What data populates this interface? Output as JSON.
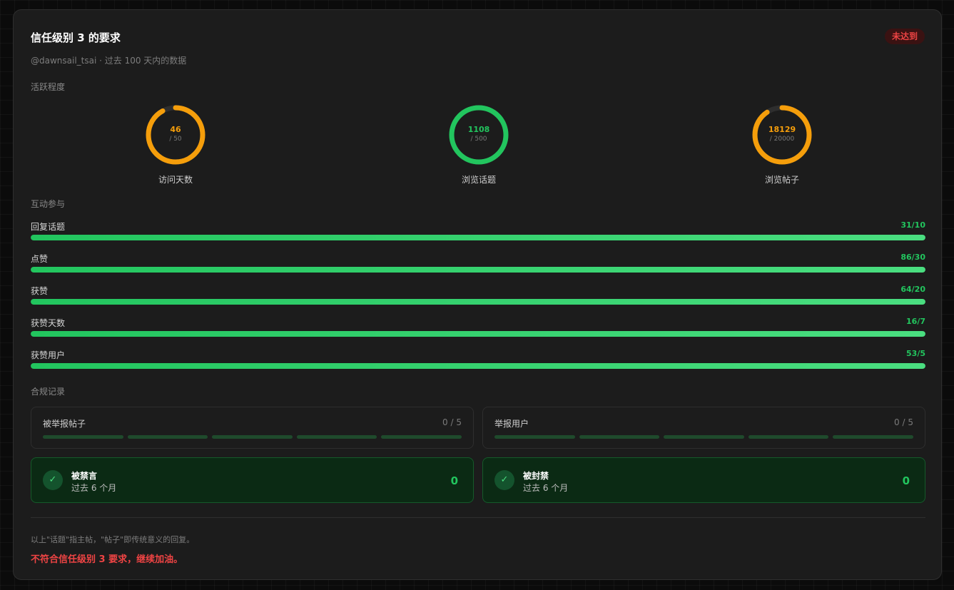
{
  "header": {
    "title": "信任级别 3 的要求",
    "badge": "未达到",
    "subtitle": "@dawnsail_tsai · 过去 100 天内的数据"
  },
  "sections": {
    "activity": "活跃程度",
    "engagement": "互动参与",
    "compliance": "合规记录"
  },
  "rings": [
    {
      "value": "46",
      "max": "/ 50",
      "label": "访问天数",
      "progress": 0.92,
      "color": "#f59e0b"
    },
    {
      "value": "1108",
      "max": "/ 500",
      "label": "浏览话题",
      "progress": 1.0,
      "color": "#22c55e"
    },
    {
      "value": "18129",
      "max": "/ 20000",
      "label": "浏览帖子",
      "progress": 0.906,
      "color": "#f59e0b"
    }
  ],
  "bars": [
    {
      "label": "回复话题",
      "value": "31/10",
      "progress": 1.0
    },
    {
      "label": "点赞",
      "value": "86/30",
      "progress": 1.0
    },
    {
      "label": "获赞",
      "value": "64/20",
      "progress": 1.0
    },
    {
      "label": "获赞天数",
      "value": "16/7",
      "progress": 1.0
    },
    {
      "label": "获赞用户",
      "value": "53/5",
      "progress": 1.0
    }
  ],
  "reports": [
    {
      "title": "被举报帖子",
      "count": "0 / 5",
      "used": 0,
      "segments": 5
    },
    {
      "title": "举报用户",
      "count": "0 / 5",
      "used": 0,
      "segments": 5
    }
  ],
  "penalties": [
    {
      "title": "被禁言",
      "sub": "过去 6 个月",
      "value": "0",
      "icon": "check-icon"
    },
    {
      "title": "被封禁",
      "sub": "过去 6 个月",
      "value": "0",
      "icon": "check-icon"
    }
  ],
  "footer": {
    "note": "以上\"话题\"指主帖，\"帖子\"即传统意义的回复。",
    "result": "不符合信任级别 3 要求，继续加油。"
  },
  "colors": {
    "success": "#22c55e",
    "warning": "#f59e0b",
    "danger": "#ef4444"
  }
}
